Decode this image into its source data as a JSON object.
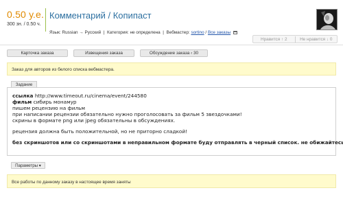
{
  "header": {
    "price": "0.50 у.е.",
    "price_sub": "300 зн. / 0.50 ч.",
    "title": "Комментарий / Копипаст"
  },
  "meta": {
    "language_label": "Язык:",
    "language_value": "Russian → Русский",
    "category_label": "Категория:",
    "category_value": "не определена",
    "webmaster_label": "Вебмастер:",
    "webmaster_value": "sortino",
    "all_orders_link": "Все заказы"
  },
  "votes": {
    "likes": "Нравится ↑ 2",
    "dislikes": "Не нравится ↓ 0"
  },
  "tabs": [
    {
      "label": "Карточка заказа"
    },
    {
      "label": "Извещения заказа"
    },
    {
      "label": "Обсуждение заказа ‹ 30"
    }
  ],
  "notice_top": "Заказ для авторов из белого списка вебмастера.",
  "task": {
    "tab_label": "Задание",
    "link_keyword": "ссылка",
    "link_url": "http://www.timeout.ru/cinema/event/244580",
    "film_keyword": "фильм",
    "film_name": "сибирь монамур",
    "line3": "пишем рецензию на фильм",
    "line4": "при написании рецензии обязательно нужно проголосовать за фильм 5 звездочками!",
    "line5": "скрины в формате png или jpeg обязательны в обсуждениях.",
    "line6": "рецензия должна быть положительной, но не приторно сладкой!",
    "line7": "без скриншотов или со скриншотами в неправильном формате буду отправлять в черный список. не обижайтесь"
  },
  "params_button": "Параметры ▾",
  "notice_bottom": "Все работы по данному заказу в настоящее время заняты",
  "colors": {
    "price": "#e08a00",
    "title": "#2c6fa0",
    "notice_bg": "#fffbcc",
    "divider": "#9bbf4a"
  }
}
